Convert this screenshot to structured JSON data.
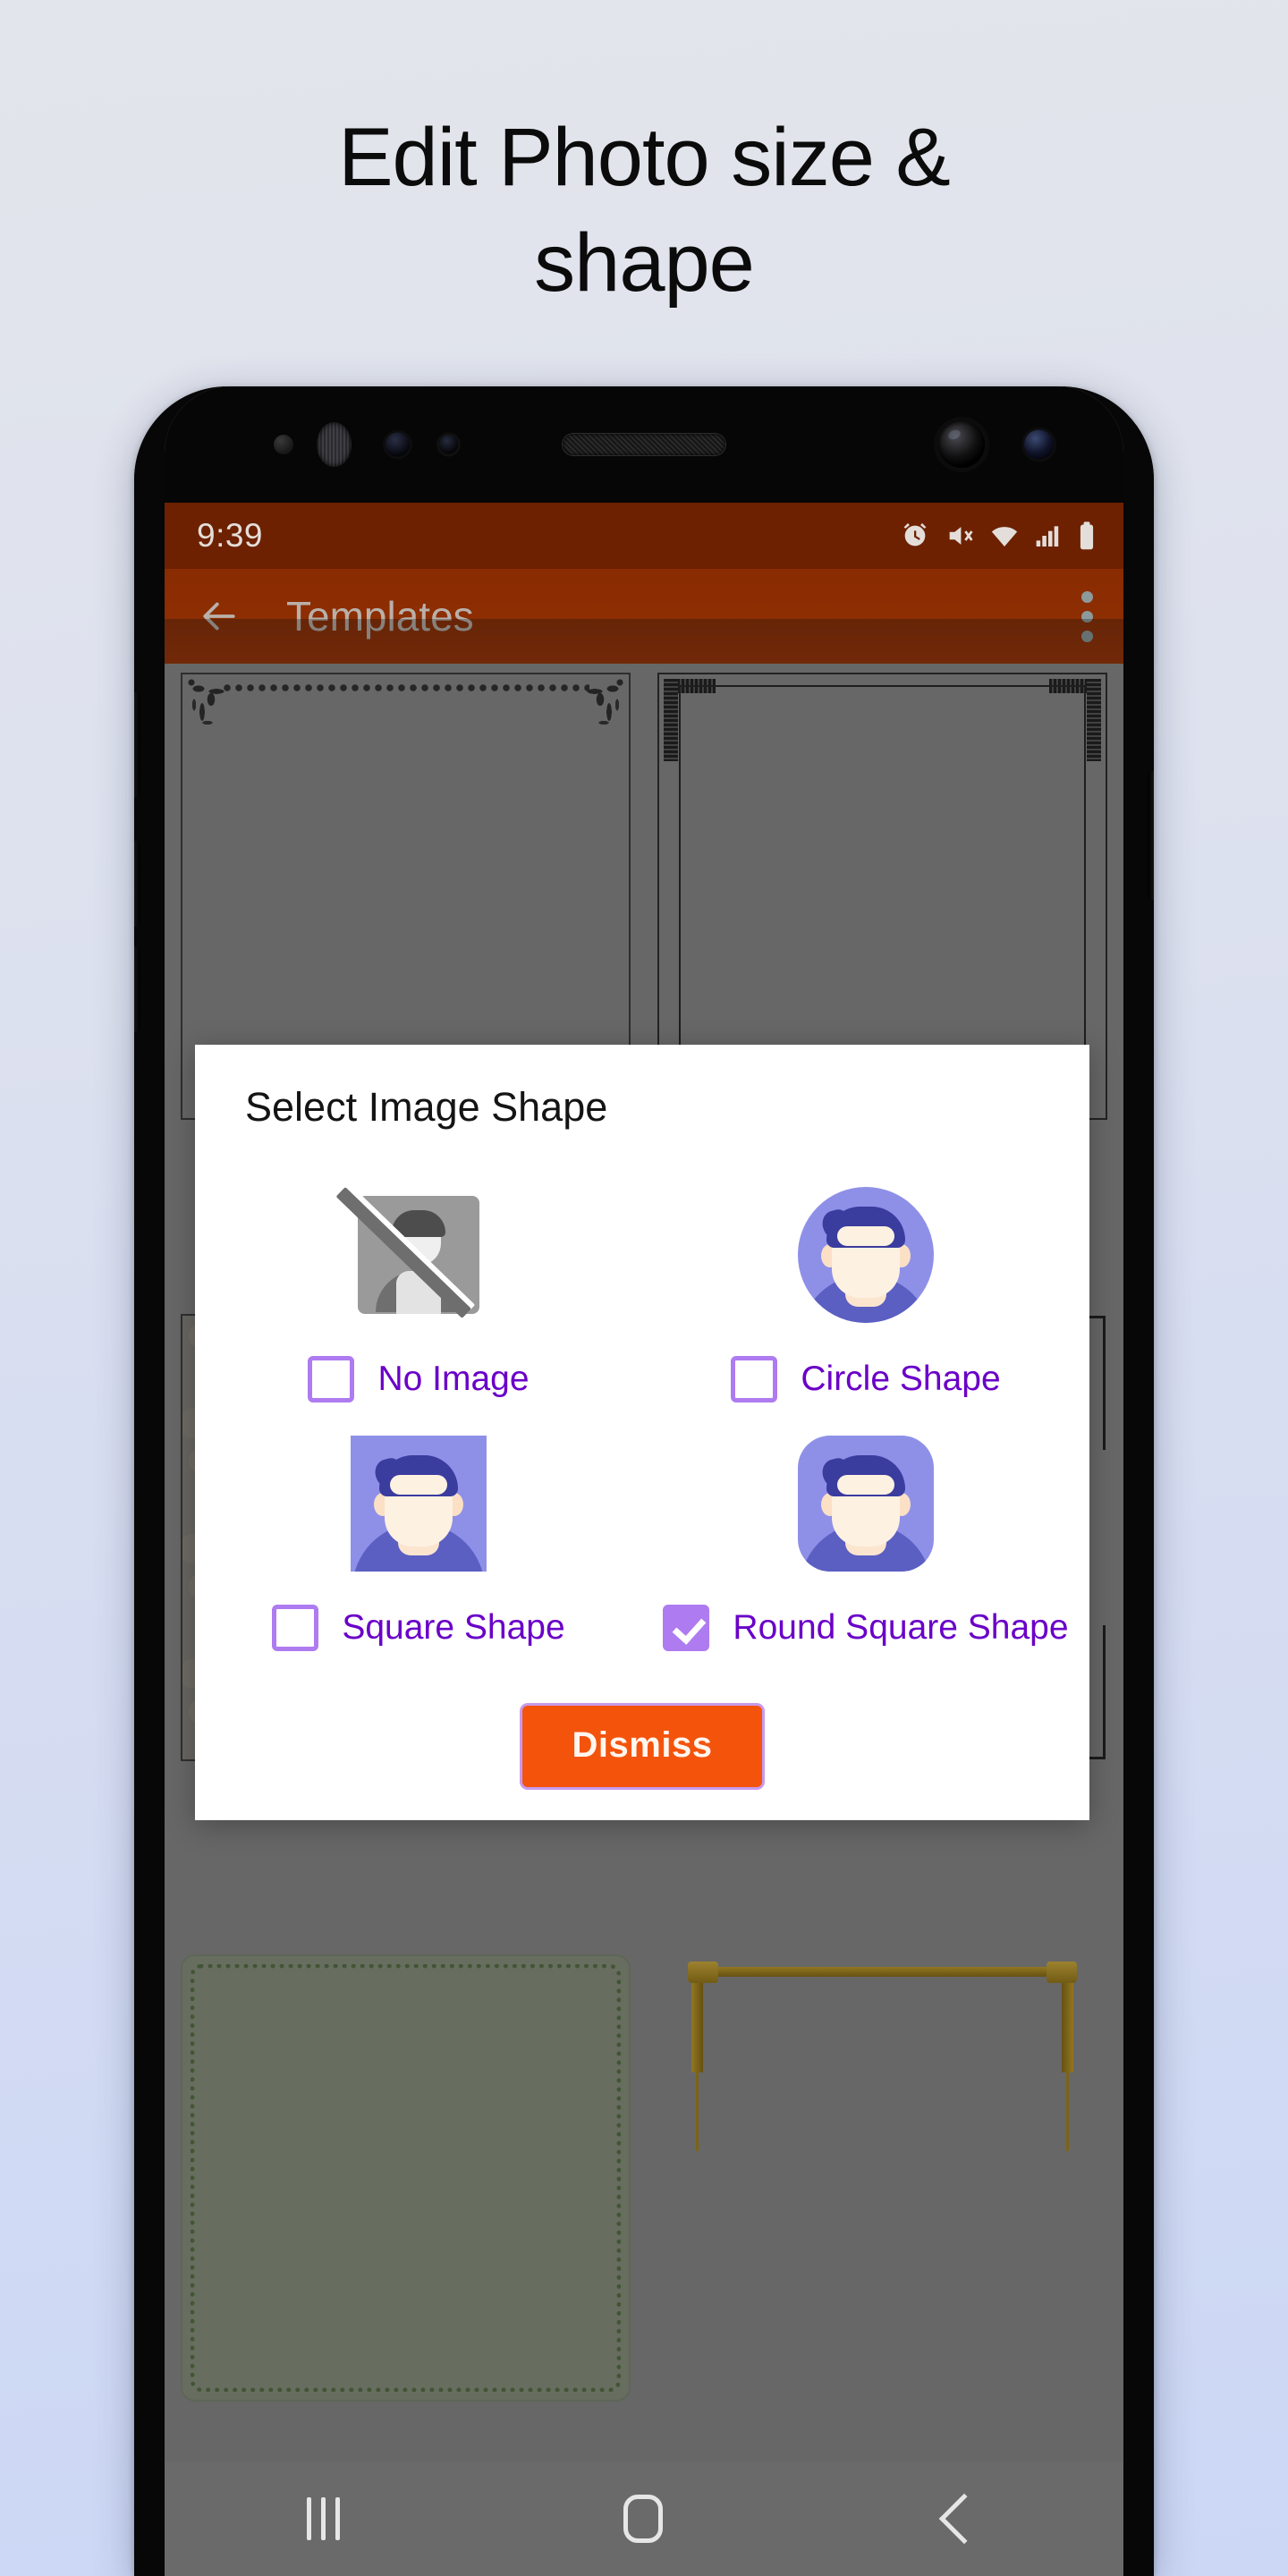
{
  "promo": {
    "headline": "Edit Photo size &\nshape"
  },
  "phone": {
    "status_bar": {
      "time": "9:39",
      "icons": [
        "alarm-icon",
        "mute-icon",
        "wifi-icon",
        "signal-icon",
        "battery-icon"
      ]
    },
    "app_bar": {
      "back_icon": "back-arrow-icon",
      "title": "Templates",
      "overflow_icon": "overflow-menu-icon"
    },
    "nav_bar": {
      "recents": "recents-icon",
      "home": "home-icon",
      "back": "back-icon"
    },
    "templates": [
      {
        "name": "ornate-corner-frame"
      },
      {
        "name": "beaded-square-frame"
      },
      {
        "name": "damask-texture-frame"
      },
      {
        "name": "plain-bracket-frame"
      },
      {
        "name": "green-leaf-frame"
      },
      {
        "name": "gold-bracket-frame"
      }
    ]
  },
  "dialog": {
    "title": "Select Image Shape",
    "options": [
      {
        "label": "No Image",
        "checked": false,
        "art": "no-image-art"
      },
      {
        "label": "Circle Shape",
        "checked": false,
        "art": "circle-avatar-art"
      },
      {
        "label": "Square Shape",
        "checked": false,
        "art": "square-avatar-art"
      },
      {
        "label": "Round Square Shape",
        "checked": true,
        "art": "round-square-avatar-art"
      }
    ],
    "dismiss_label": "Dismiss"
  },
  "colors": {
    "background_top": "#E3E5EC",
    "background_bottom": "#CBD7F5",
    "app_bar": "#8C2D02",
    "status_bar": "#6D2100",
    "accent_purple": "#AE7BF0",
    "label_purple": "#6A00C8",
    "dismiss_orange": "#F4530C",
    "screen_gray": "#8C8C8C",
    "avatar_bg": "#8E90E8",
    "avatar_hair": "#3A3C9E",
    "avatar_shirt": "#5B5FC2",
    "avatar_skin": "#FDF1E2"
  }
}
